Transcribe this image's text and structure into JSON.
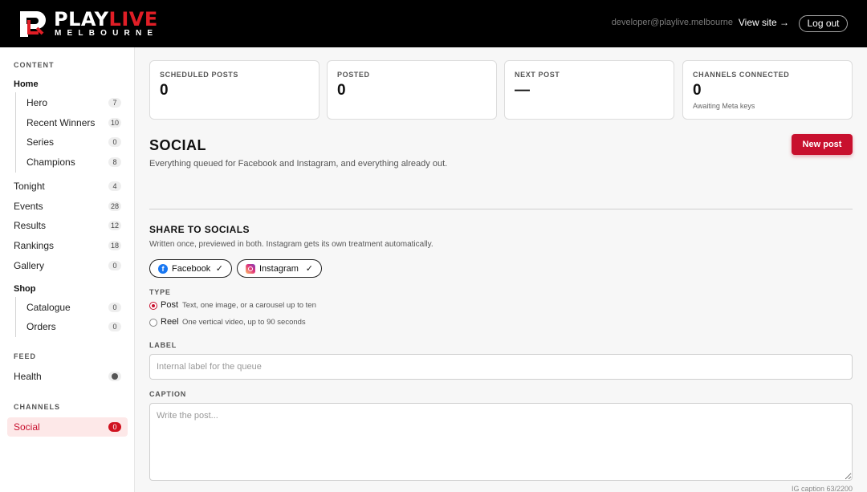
{
  "brand": {
    "name_white": "PLAY",
    "name_red": "LIVE",
    "sub": "MELBOURNE",
    "accent": "#e01e26"
  },
  "header": {
    "email": "developer@playlive.melbourne",
    "view_site": "View site →",
    "logout": "Log out"
  },
  "sidebar": {
    "content_label": "CONTENT",
    "home_title": "Home",
    "home_items": [
      {
        "label": "Hero",
        "count": "7"
      },
      {
        "label": "Recent Winners",
        "count": "10"
      },
      {
        "label": "Series",
        "count": "0"
      },
      {
        "label": "Champions",
        "count": "8"
      }
    ],
    "items": [
      {
        "label": "Tonight",
        "count": "4"
      },
      {
        "label": "Events",
        "count": "28"
      },
      {
        "label": "Results",
        "count": "12"
      },
      {
        "label": "Rankings",
        "count": "18"
      },
      {
        "label": "Gallery",
        "count": "0"
      }
    ],
    "shop_title": "Shop",
    "shop_items": [
      {
        "label": "Catalogue",
        "count": "0"
      },
      {
        "label": "Orders",
        "count": "0"
      }
    ],
    "feed_label": "FEED",
    "feed_items": [
      {
        "label": "Health",
        "icon": "status-dot-icon"
      }
    ],
    "channels_label": "CHANNELS",
    "channel_items": [
      {
        "label": "Social",
        "count": "0"
      }
    ]
  },
  "stats": [
    {
      "title": "SCHEDULED POSTS",
      "value": "0",
      "sub": ""
    },
    {
      "title": "POSTED",
      "value": "0",
      "sub": ""
    },
    {
      "title": "NEXT POST",
      "value": "—",
      "sub": ""
    },
    {
      "title": "CHANNELS CONNECTED",
      "value": "0",
      "sub": "Awaiting Meta keys"
    }
  ],
  "page": {
    "title": "SOCIAL",
    "subtitle": "Everything queued for Facebook and Instagram, and everything already out.",
    "new_post": "New post"
  },
  "share": {
    "title": "SHARE TO SOCIALS",
    "subtitle": "Written once, previewed in both. Instagram gets its own treatment automatically.",
    "channels": [
      {
        "label": "Facebook",
        "check": "✓",
        "icon": "facebook-icon"
      },
      {
        "label": "Instagram",
        "check": "✓",
        "icon": "instagram-icon"
      }
    ],
    "type_label": "TYPE",
    "types": [
      {
        "label": "Post",
        "desc": "Text, one image, or a carousel up to ten",
        "selected": true
      },
      {
        "label": "Reel",
        "desc": "One vertical video, up to 90 seconds",
        "selected": false
      }
    ],
    "label_label": "LABEL",
    "label_placeholder": "Internal label for the queue",
    "caption_label": "CAPTION",
    "caption_placeholder": "Write the post...",
    "caption_counter": "IG caption 63/2200"
  }
}
